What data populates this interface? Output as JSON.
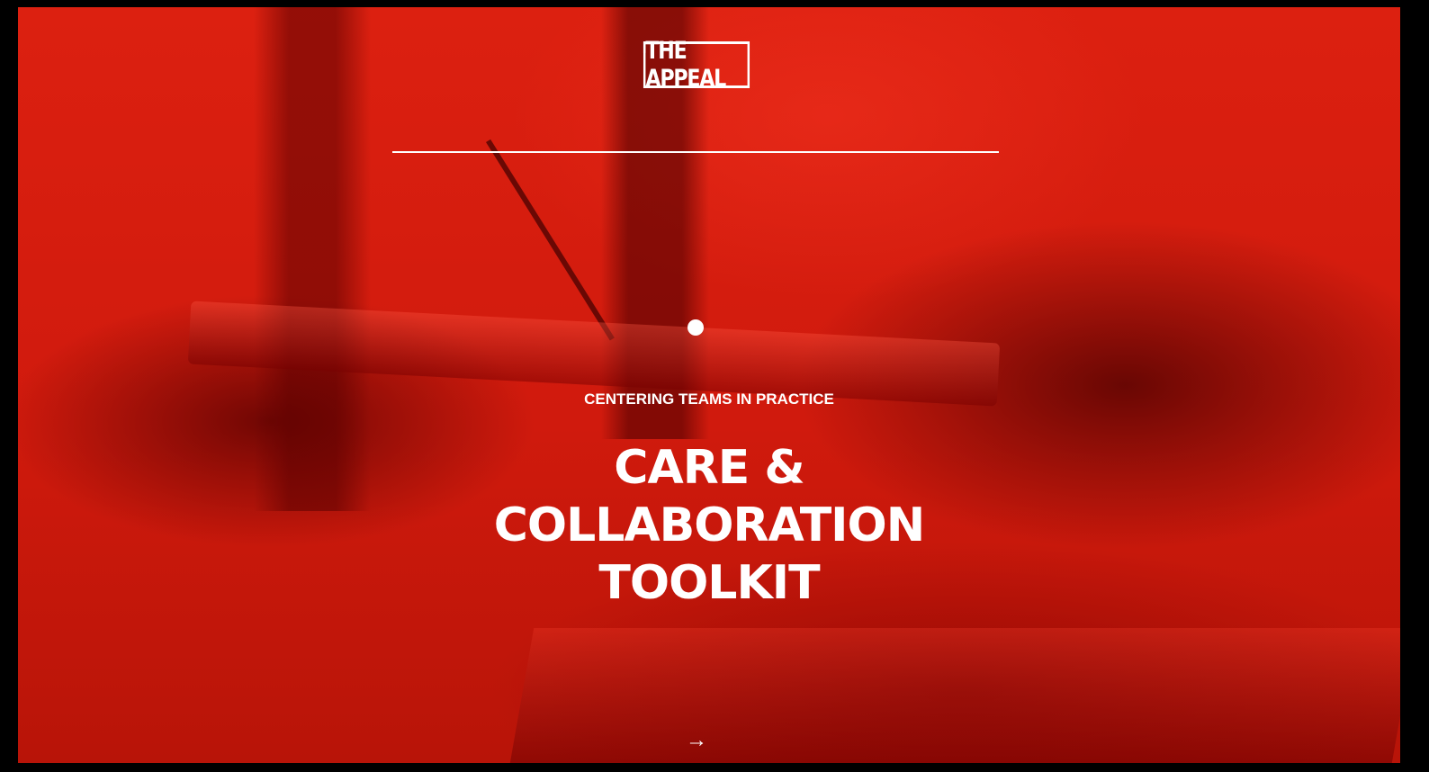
{
  "brand": {
    "logo_text": "THE APPEAL"
  },
  "hero": {
    "eyebrow": "CENTERING TEAMS IN PRACTICE",
    "title_lines": [
      "CARE &",
      "COLLABORATION",
      "TOOLKIT"
    ],
    "next_arrow": "→"
  },
  "colors": {
    "accent_red": "#d81a0c",
    "text": "#ffffff",
    "frame": "#000000"
  },
  "icons": {
    "next": "arrow-right-icon",
    "indicator": "slide-dot-icon"
  }
}
